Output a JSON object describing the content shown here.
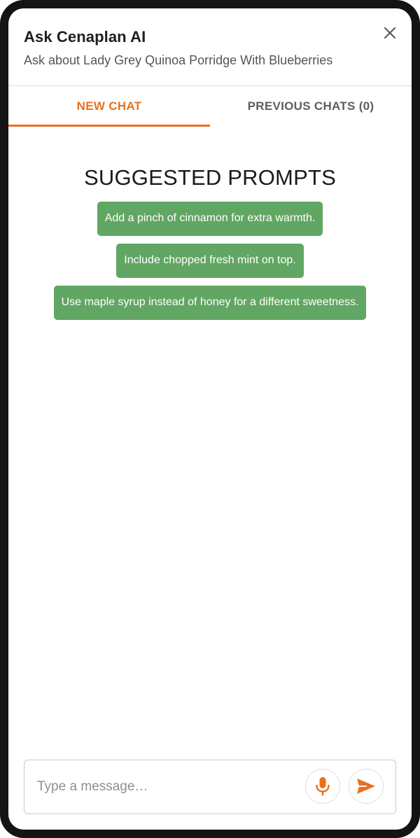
{
  "header": {
    "title": "Ask Cenaplan AI",
    "subtitle": "Ask about Lady Grey Quinoa Porridge With Blueberries",
    "close_icon": "close-icon"
  },
  "tabs": [
    {
      "label": "NEW CHAT",
      "active": true
    },
    {
      "label": "PREVIOUS CHATS (0)",
      "active": false
    }
  ],
  "suggested": {
    "title": "SUGGESTED PROMPTS",
    "prompts": [
      "Add a pinch of cinnamon for extra warmth.",
      "Include chopped fresh mint on top.",
      "Use maple syrup instead of honey for a different sweetness."
    ]
  },
  "composer": {
    "placeholder": "Type a message…",
    "value": "",
    "mic_icon": "microphone-icon",
    "send_icon": "send-icon"
  },
  "colors": {
    "accent": "#e8711c",
    "prompt_bg": "#61a663",
    "frame": "#141414"
  }
}
